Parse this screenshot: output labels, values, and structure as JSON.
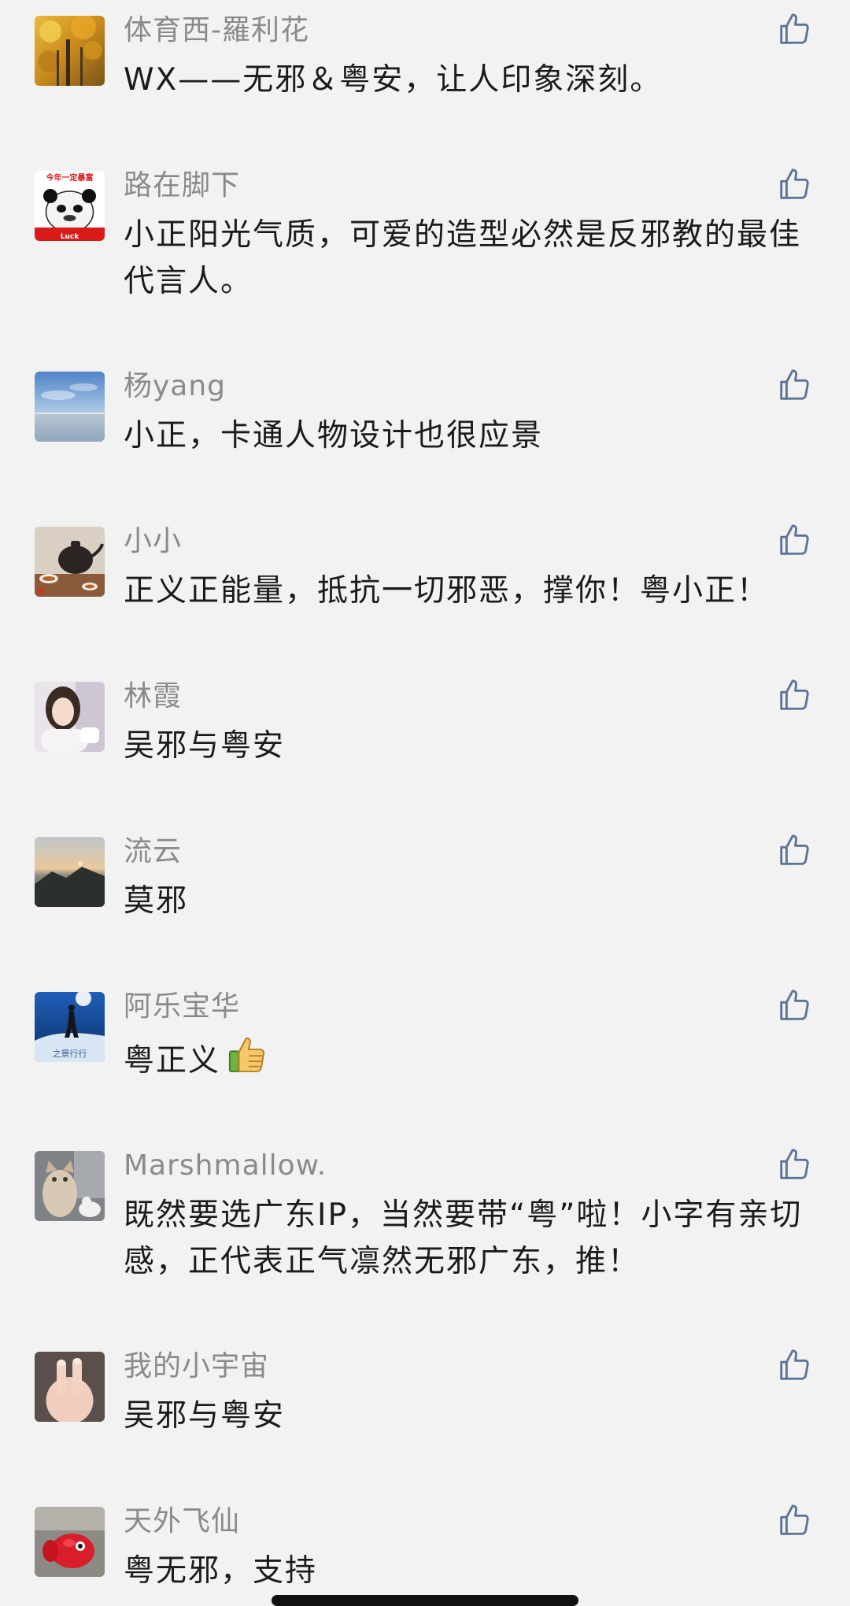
{
  "comments": [
    {
      "username": "体育西-羅利花",
      "content": "WX——无邪＆粤安，让人印象深刻。",
      "avatar": "golden-tree-photo"
    },
    {
      "username": "路在脚下",
      "content": "小正阳光气质，可爱的造型必然是反邪教的最佳代言人。",
      "avatar": "panda-meme-photo",
      "avatar_text": {
        "top": "今年一定暴富",
        "bottom": "Luck"
      }
    },
    {
      "username": "杨yang",
      "content": "小正，卡通人物设计也很应景",
      "avatar": "sky-lake-photo"
    },
    {
      "username": "小小",
      "content": "正义正能量，抵抗一切邪恶，撑你！粤小正！",
      "avatar": "teapot-photo"
    },
    {
      "username": "林霞",
      "content": "吴邪与粤安",
      "avatar": "woman-portrait-photo"
    },
    {
      "username": "流云",
      "content": "莫邪",
      "avatar": "mountain-sunrise-photo"
    },
    {
      "username": "阿乐宝华",
      "content": "粤正义",
      "emoji": "thumbs-up-emoji",
      "avatar": "snow-hiker-photo",
      "avatar_text": {
        "bottom": "之景行行"
      }
    },
    {
      "username": "Marshmallow.",
      "content": "既然要选广东IP，当然要带“粤”啦！小字有亲切感，正代表正气凛然无邪广东，推！",
      "avatar": "cat-photo"
    },
    {
      "username": "我的小宇宙",
      "content": "吴邪与粤安",
      "avatar": "hand-peace-photo"
    },
    {
      "username": "天外飞仙",
      "content": "粤无邪，支持",
      "avatar": "red-toy-photo"
    }
  ],
  "icons": {
    "like": "thumbs-up-outline-icon"
  },
  "colors": {
    "background": "#f2f2f2",
    "username": "#8a8a8a",
    "content": "#1b1b1b",
    "like_icon": "#5d7396"
  }
}
